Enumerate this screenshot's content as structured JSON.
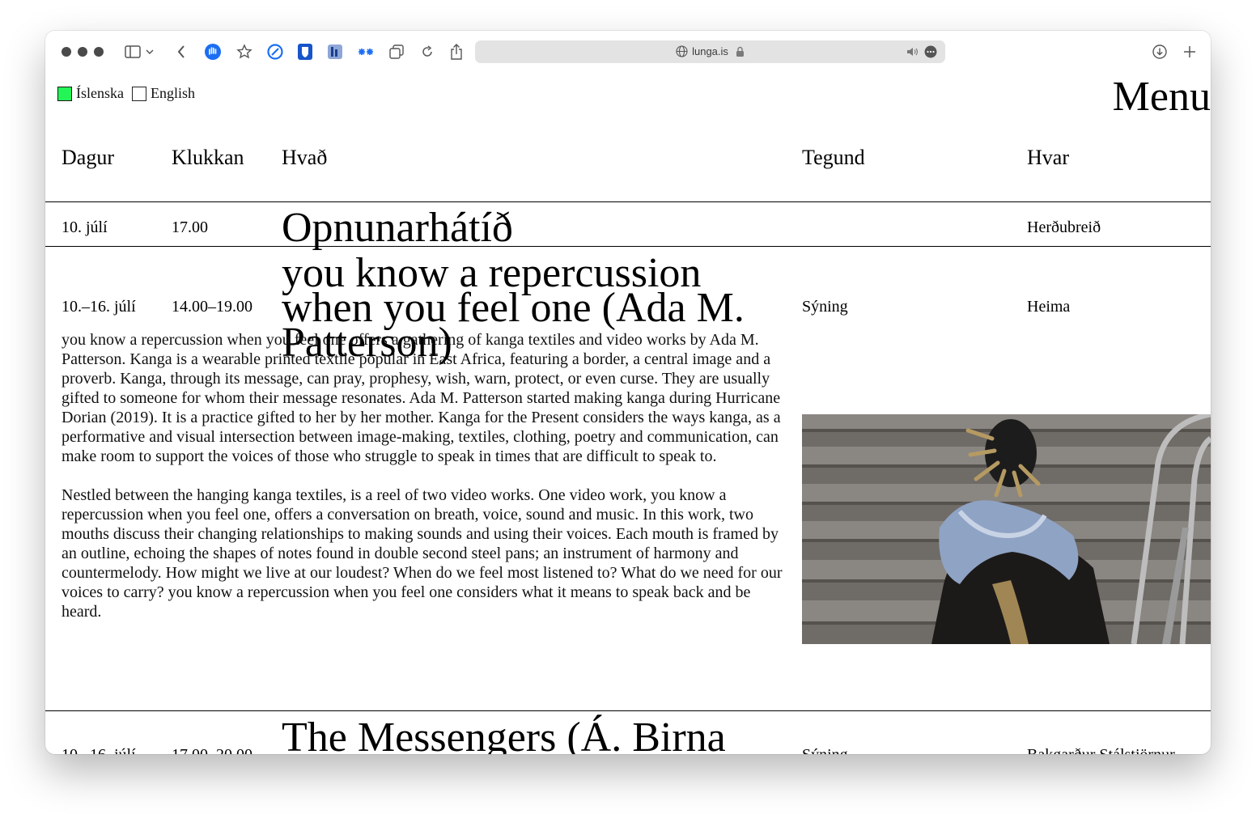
{
  "browser": {
    "url": "lunga.is"
  },
  "page": {
    "languages": [
      {
        "label": "Íslenska",
        "checked": true
      },
      {
        "label": "English",
        "checked": false
      }
    ],
    "menu_label": "Menu",
    "columns": {
      "day": "Dagur",
      "time": "Klukkan",
      "what": "Hvað",
      "type": "Tegund",
      "where": "Hvar"
    },
    "events": [
      {
        "day": "10. júlí",
        "time": "17.00",
        "title": "Opnunarhátíð",
        "type": "",
        "where": "Herðubreið"
      },
      {
        "day": "10.–16. júlí",
        "time": "14.00–19.00",
        "title": "you know a repercussion when you feel one (Ada M. Patterson)",
        "type": "Sýning",
        "where": "Heima",
        "description": [
          "you know a repercussion when you feel one offers a gathering of kanga textiles and video works by Ada M. Patterson. Kanga is a wearable printed textile popular in East Africa, featuring a border, a central image and a proverb. Kanga, through its message, can pray, prophesy, wish, warn, protect, or even curse. They are usually gifted to someone for whom their message resonates. Ada M. Patterson started making kanga during Hurricane Dorian (2019). It is a practice gifted to her by her mother. Kanga for the Present considers the ways kanga, as a performative and visual intersection between image-making, textiles, clothing, poetry and communication, can make room to support the voices of those who struggle to speak in times that are difficult to speak to.",
          "Nestled between the hanging kanga textiles, is a reel of two video works. One video work, you know a repercussion when you feel one, offers a conversation on breath, voice, sound and music. In this work, two mouths discuss their changing relationships to making sounds and using their voices. Each mouth is framed by an outline, echoing the shapes of notes found in double second steel pans; an instrument of harmony and countermelody. How might we live at our loudest? When do we feel most listened to? What do we need for our voices to carry? you know a repercussion when you feel one considers what it means to speak back and be heard."
        ]
      },
      {
        "day": "10.–16. júlí",
        "time": "17.00–20.00",
        "title": "The Messengers (Á. Birna Björnsdóttir)",
        "type": "Sýning",
        "where": "Bakgarður Stálstjörnur"
      }
    ]
  },
  "colors": {
    "checkbox_checked": "#22f555",
    "text": "#000000",
    "background": "#ffffff",
    "toolbar_blue": "#1b6ef3"
  }
}
